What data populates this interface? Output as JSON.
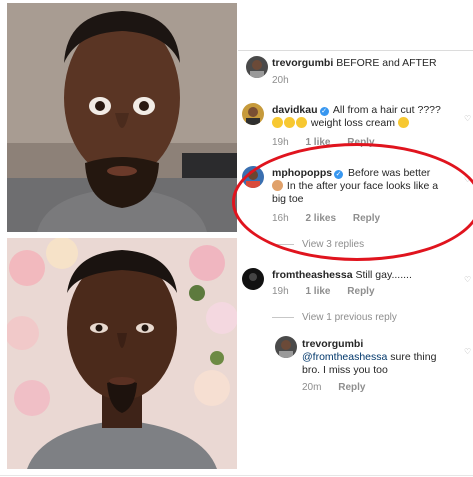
{
  "comments": [
    {
      "username": "trevorgumbi",
      "text": "BEFORE and AFTER",
      "time": "20h"
    },
    {
      "username": "davidkau",
      "verified": true,
      "text": "All from a hair cut ????",
      "text_line2": "weight loss cream",
      "emojis_line2": [
        "thinking-emoji",
        "thinking-emoji",
        "thinking-emoji"
      ],
      "trailing_emoji": "smile-emoji",
      "time": "19h",
      "likes": "1 like",
      "reply": "Reply"
    },
    {
      "username": "mphopopps",
      "verified": true,
      "text": "Before was better",
      "text_line2": "In the after your face looks like a",
      "text_line3": "big toe",
      "leading_emoji_line2": "facepalm-emoji",
      "time": "16h",
      "likes": "2 likes",
      "reply": "Reply",
      "view_replies": "View 3 replies"
    },
    {
      "username": "fromtheashessa",
      "text": "Still gay.......",
      "time": "19h",
      "likes": "1 like",
      "reply": "Reply",
      "view_replies": "View 1 previous reply"
    },
    {
      "username": "trevorgumbi",
      "mention": "@fromtheashessa",
      "text": "sure thing",
      "text_line2": "bro. I miss you too",
      "time": "20m",
      "reply": "Reply"
    }
  ],
  "colors": {
    "highlight_ellipse": "#e0141e",
    "verified_badge": "#3897f0",
    "mention": "#00376b",
    "meta_text": "#8e8e8e"
  }
}
